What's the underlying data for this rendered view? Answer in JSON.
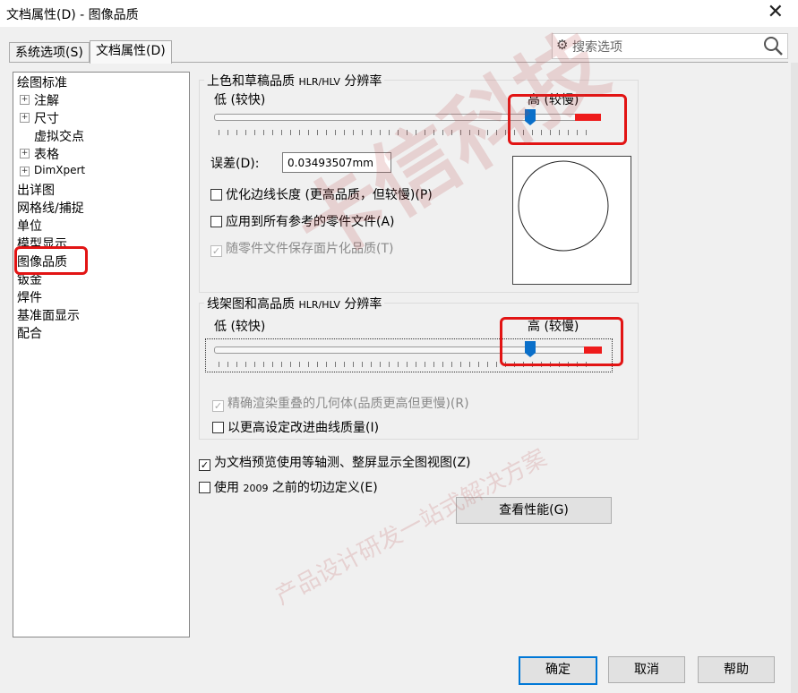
{
  "window": {
    "title": "文档属性(D) - 图像品质",
    "close_glyph": "✕"
  },
  "tabs": [
    {
      "label": "系统选项(S)",
      "active": false
    },
    {
      "label": "文档属性(D)",
      "active": true
    }
  ],
  "search": {
    "placeholder": "搜索选项"
  },
  "tree": [
    {
      "label": "绘图标准"
    },
    {
      "label": "注解",
      "expandable": true
    },
    {
      "label": "尺寸",
      "expandable": true
    },
    {
      "label": "虚拟交点"
    },
    {
      "label": "表格",
      "expandable": true
    },
    {
      "label": "DimXpert",
      "expandable": true
    },
    {
      "label": "出详图"
    },
    {
      "label": "网格线/捕捉"
    },
    {
      "label": "单位"
    },
    {
      "label": "模型显示"
    },
    {
      "label": "图像品质",
      "selected": true
    },
    {
      "label": "钣金"
    },
    {
      "label": "焊件"
    },
    {
      "label": "基准面显示"
    },
    {
      "label": "配合"
    }
  ],
  "shaded": {
    "title_main": "上色和草稿品质 ",
    "title_small": "HLR/HLV",
    "title_end": " 分辨率",
    "low_label": "低 (较快)",
    "high_label": "高 (较慢)",
    "slider_value": 0.82,
    "tolerance_label": "误差(D):",
    "tolerance_value": "0.03493507mm",
    "opt_optimize": {
      "label": "优化边线长度 (更高品质，但较慢)(P)",
      "checked": false,
      "enabled": true
    },
    "opt_apply": {
      "label": "应用到所有参考的零件文件(A)",
      "checked": false,
      "enabled": true
    },
    "opt_save": {
      "label": "随零件文件保存面片化品质(T)",
      "checked": true,
      "enabled": false
    }
  },
  "wireframe": {
    "title_main": "线架图和高品质 ",
    "title_small": "HLR/HLV",
    "title_end": " 分辨率",
    "low_label": "低 (较快)",
    "high_label": "高 (较慢)",
    "slider_value": 0.82,
    "opt_precise": {
      "label": "精确渲染重叠的几何体(品质更高但更慢)(R)",
      "checked": true,
      "enabled": false
    },
    "opt_curve": {
      "label": "以更高设定改进曲线质量(I)",
      "checked": false,
      "enabled": true
    }
  },
  "general": {
    "opt_isometric": {
      "label": "为文档预览使用等轴测、整屏显示全图视图(Z)",
      "checked": true
    },
    "opt_pre2009_a": "使用 ",
    "opt_pre2009_b": "2009",
    "opt_pre2009_c": " 之前的切边定义(E)",
    "opt_pre2009_checked": false,
    "performance_button": "查看性能(G)"
  },
  "footer": {
    "ok": "确定",
    "cancel": "取消",
    "help": "帮助"
  },
  "watermark": {
    "main": "卡信科技",
    "sub": "产品设计研发一站式解决方案"
  },
  "colors": {
    "highlight_red": "#e21414",
    "thumb_blue": "#0a6fc9",
    "primary_border": "#0078d7"
  }
}
